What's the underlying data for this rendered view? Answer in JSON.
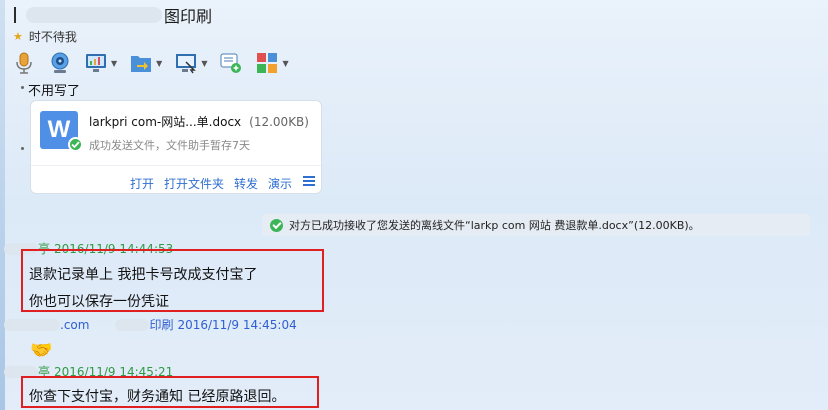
{
  "header": {
    "title_suffix": "图印刷",
    "status": "时不待我"
  },
  "toolbar": {
    "icons": [
      "microphone-icon",
      "webcam-icon",
      "screen-share-icon",
      "send-file-icon",
      "screenshot-icon",
      "message-add-icon",
      "apps-icon"
    ]
  },
  "chat": {
    "quote_text": "不用写了",
    "file_card": {
      "name": "larkpri    com-网站...单.docx",
      "size": "(12.00KB)",
      "status": "成功发送文件，文件助手暂存7天",
      "actions": [
        "打开",
        "打开文件夹",
        "转发",
        "演示"
      ]
    },
    "system_message": "对方已成功接收了您发送的离线文件“larkp         com  网站      费退款单.docx”(12.00KB)。",
    "messages": [
      {
        "sender_suffix": "亭",
        "time": "2016/11/9 14:44:53",
        "lines": [
          "退款记录单上 我把卡号改成支付宝了",
          "你也可以保存一份凭证"
        ]
      },
      {
        "sender_prefix": ".com",
        "sender_suffix": "印刷",
        "time": "2016/11/9 14:45:04",
        "emoji": "🤝"
      },
      {
        "sender_suffix": "亭",
        "time": "2016/11/9 14:45:21",
        "lines": [
          "你查下支付宝，财务通知 已经原路退回。"
        ]
      }
    ]
  },
  "colors": {
    "highlight_border": "#e02020",
    "link": "#2f6fd1",
    "peer_name": "#2f9a44",
    "self_name": "#2f5fd1"
  }
}
